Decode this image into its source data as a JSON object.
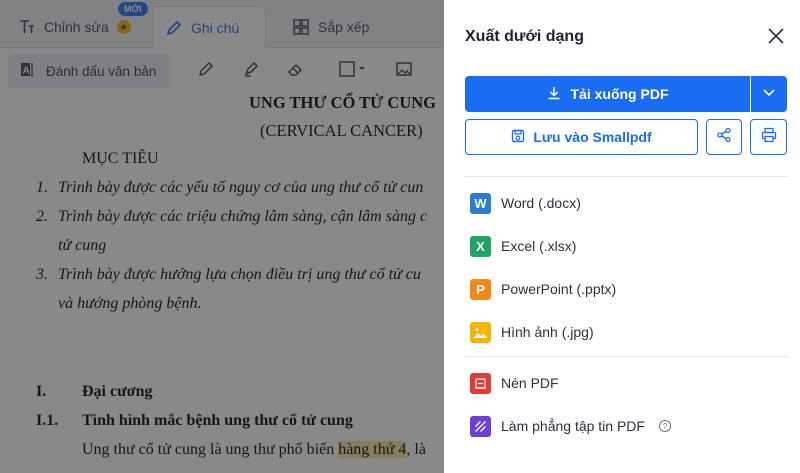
{
  "tabs": {
    "edit": "Chỉnh sửa",
    "note": "Ghi chú",
    "arrange": "Sắp xếp",
    "new_badge": "MỚI"
  },
  "toolbar": {
    "mark_text": "Đánh dấu văn bản"
  },
  "document": {
    "title": "UNG THƯ CỔ TỬ CUNG",
    "subtitle": "(CERVICAL CANCER)",
    "objectives_heading": "MỤC TIÊU",
    "obj1_num": "1.",
    "obj1": "Trình bày được các yếu tố nguy cơ của ung thư cổ tử cun",
    "obj2_num": "2.",
    "obj2": "Trình bày được các triệu chứng lâm sàng, cận lâm sàng c",
    "obj2_cont": "tử cung",
    "obj3_num": "3.",
    "obj3": "Trình bày được hướng lựa chọn điều trị ung thư cổ tử cu",
    "obj3_cont": "và hướng phòng bệnh.",
    "sec1_num": "I.",
    "sec1": "Đại cương",
    "sec11_num": "I.1.",
    "sec11": "Tình hình mắc bệnh ung thư cổ tử cung",
    "para_start": "Ung thư cổ tử cung là ung thư phổ biến ",
    "para_hl": "hàng thứ 4",
    "para_end": ", là"
  },
  "export_panel": {
    "title": "Xuất dưới dạng",
    "download_label": "Tải xuống PDF",
    "save_label": "Lưu vào Smallpdf",
    "formats": [
      {
        "label": "Word (.docx)",
        "icon": "word-icon",
        "glyph": "W",
        "color": "#2b7cd3"
      },
      {
        "label": "Excel (.xlsx)",
        "icon": "excel-icon",
        "glyph": "X",
        "color": "#1fa463"
      },
      {
        "label": "PowerPoint (.pptx)",
        "icon": "powerpoint-icon",
        "glyph": "P",
        "color": "#f28a1a"
      },
      {
        "label": "Hình ảnh (.jpg)",
        "icon": "image-icon",
        "glyph": "",
        "color": "#f5b400"
      }
    ],
    "tools": [
      {
        "label": "Nén PDF",
        "icon": "compress-pdf-icon",
        "color": "#e53935"
      },
      {
        "label": "Làm phẳng tập tin PDF",
        "icon": "flatten-pdf-icon",
        "color": "#6c3fd8"
      }
    ],
    "help_glyph": "?"
  },
  "colors": {
    "accent": "#1a6cf2",
    "overlay": "rgba(40,40,40,0.55)",
    "highlight": "#fbe39a"
  }
}
